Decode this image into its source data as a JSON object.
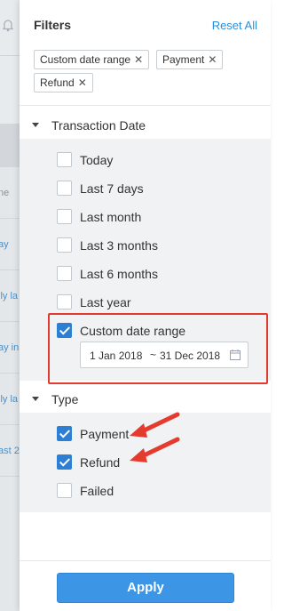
{
  "background_page": {
    "row_fragments": [
      "ne",
      "ay",
      "ily la",
      "ay in",
      "ily la",
      "ast 2"
    ]
  },
  "panel": {
    "title": "Filters",
    "reset_label": "Reset All",
    "chips": [
      {
        "label": "Custom date range"
      },
      {
        "label": "Payment"
      },
      {
        "label": "Refund"
      }
    ],
    "chip_remove_glyph": "✕",
    "sections": {
      "transaction_date": {
        "label": "Transaction Date",
        "options": [
          {
            "label": "Today",
            "checked": false
          },
          {
            "label": "Last 7 days",
            "checked": false
          },
          {
            "label": "Last month",
            "checked": false
          },
          {
            "label": "Last 3 months",
            "checked": false
          },
          {
            "label": "Last 6 months",
            "checked": false
          },
          {
            "label": "Last year",
            "checked": false
          },
          {
            "label": "Custom date range",
            "checked": true
          }
        ],
        "date_range": {
          "from": "1 Jan 2018",
          "separator": "~",
          "to": "31 Dec 2018"
        }
      },
      "type": {
        "label": "Type",
        "options": [
          {
            "label": "Payment",
            "checked": true
          },
          {
            "label": "Refund",
            "checked": true
          },
          {
            "label": "Failed",
            "checked": false
          }
        ]
      }
    },
    "apply_label": "Apply"
  },
  "colors": {
    "accent": "#2d7fd3",
    "link": "#2b8ed6",
    "annotation_red": "#e53b2e",
    "apply_button": "#3d95e6",
    "section_bg": "#f0f2f4",
    "background_text": "#4a90c8"
  },
  "icons": {
    "bell": "bell-icon",
    "caret": "caret-down-icon",
    "calendar": "calendar-icon",
    "arrow": "red-arrow-annotation"
  }
}
